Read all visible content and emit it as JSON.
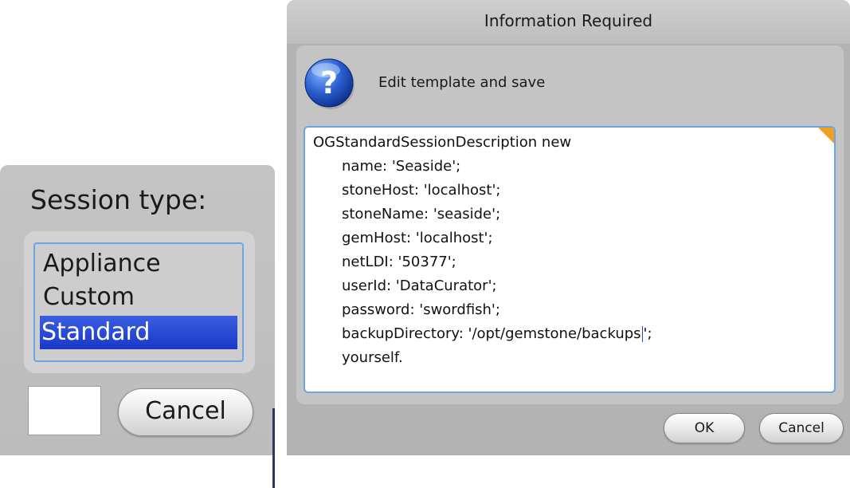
{
  "session_dialog": {
    "title": "Session type:",
    "options": [
      {
        "label": "Appliance",
        "selected": false
      },
      {
        "label": "Custom",
        "selected": false
      },
      {
        "label": "Standard",
        "selected": true
      }
    ],
    "cancel_label": "Cancel",
    "selection_color": "#2a4ad8"
  },
  "info_dialog": {
    "title": "Information Required",
    "icon": "question-icon",
    "message": "Edit template and save",
    "editor": {
      "lines": [
        "OGStandardSessionDescription new",
        "name: 'Seaside';",
        "stoneHost: 'localhost';",
        "stoneName: 'seaside';",
        "gemHost: 'localhost';",
        "netLDI: '50377';",
        "userId: 'DataCurator';",
        "password: 'swordfish';",
        "backupDirectory: '/opt/gemstone/backups",
        "';",
        "yourself."
      ],
      "focus_color": "#6aa6e6",
      "corner_color": "#f0a020"
    },
    "ok_label": "OK",
    "cancel_label": "Cancel"
  }
}
